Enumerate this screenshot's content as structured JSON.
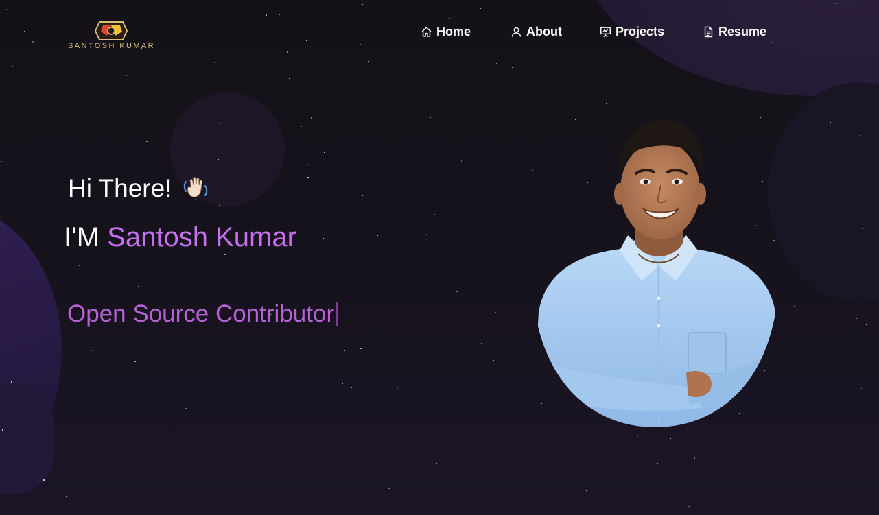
{
  "brand": {
    "logo_text": "SANTOSH KUMAR",
    "logo_icon": "hexagon-logo-icon",
    "logo_colors": [
      "#d8c07a",
      "#e0462e",
      "#f2c230"
    ]
  },
  "nav": {
    "items": [
      {
        "label": "Home",
        "icon": "home-icon"
      },
      {
        "label": "About",
        "icon": "user-icon"
      },
      {
        "label": "Projects",
        "icon": "presentation-icon"
      },
      {
        "label": "Resume",
        "icon": "document-icon"
      }
    ]
  },
  "hero": {
    "greeting": "Hi There!",
    "greeting_icon": "waving-hand-icon",
    "intro_prefix": "I'M",
    "name": "Santosh Kumar",
    "role": "Open Source Contributor"
  },
  "portrait": {
    "subject": "profile-photo"
  },
  "colors": {
    "background": "#151219",
    "accent": "#c770f0",
    "role_text": "#b562d6",
    "text": "#ffffff",
    "shirt": "#a9cdf2"
  }
}
